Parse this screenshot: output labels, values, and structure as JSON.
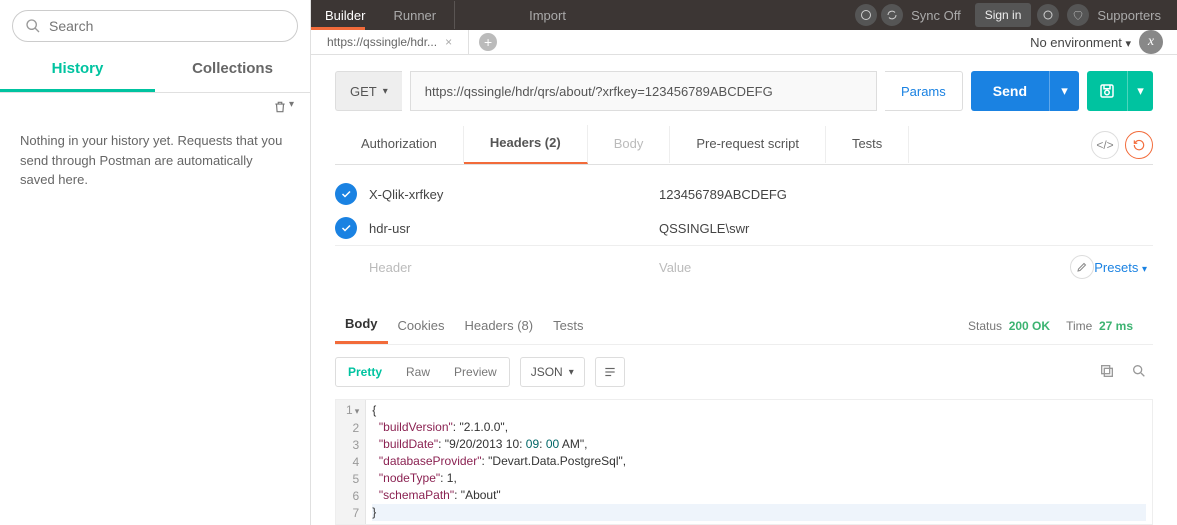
{
  "sidebar": {
    "search_placeholder": "Search",
    "tabs": {
      "history": "History",
      "collections": "Collections"
    },
    "empty_history": "Nothing in your history yet. Requests that you send through Postman are automatically saved here."
  },
  "topbar": {
    "builder": "Builder",
    "runner": "Runner",
    "import": "Import",
    "sync_off": "Sync Off",
    "sign_in": "Sign in",
    "supporters": "Supporters"
  },
  "request_tab": {
    "title": "https://qssingle/hdr..."
  },
  "environment": {
    "label": "No environment"
  },
  "request": {
    "method": "GET",
    "url": "https://qssingle/hdr/qrs/about/?xrfkey=123456789ABCDEFG",
    "params_label": "Params",
    "send_label": "Send"
  },
  "subtabs": {
    "authorization": "Authorization",
    "headers": "Headers (2)",
    "body": "Body",
    "prerequest": "Pre-request script",
    "tests": "Tests"
  },
  "headers": {
    "rows": [
      {
        "key": "X-Qlik-xrfkey",
        "value": "123456789ABCDEFG"
      },
      {
        "key": "hdr-usr",
        "value": "QSSINGLE\\swr"
      }
    ],
    "placeholder_key": "Header",
    "placeholder_value": "Value",
    "presets": "Presets"
  },
  "response": {
    "tabs": {
      "body": "Body",
      "cookies": "Cookies",
      "headers": "Headers (8)",
      "tests": "Tests"
    },
    "status_label": "Status",
    "status_value": "200 OK",
    "time_label": "Time",
    "time_value": "27 ms",
    "format": {
      "pretty": "Pretty",
      "raw": "Raw",
      "preview": "Preview",
      "lang": "JSON"
    },
    "json_lines": [
      "{",
      "  \"buildVersion\": \"2.1.0.0\",",
      "  \"buildDate\": \"9/20/2013 10:09:00 AM\",",
      "  \"databaseProvider\": \"Devart.Data.PostgreSql\",",
      "  \"nodeType\": 1,",
      "  \"schemaPath\": \"About\"",
      "}"
    ]
  }
}
